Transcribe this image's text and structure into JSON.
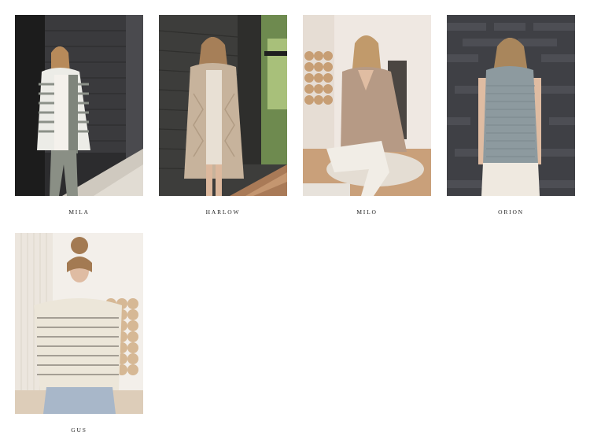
{
  "products": [
    {
      "name": "MILA"
    },
    {
      "name": "HARLOW"
    },
    {
      "name": "MILO"
    },
    {
      "name": "ORION"
    },
    {
      "name": "GUS"
    }
  ]
}
